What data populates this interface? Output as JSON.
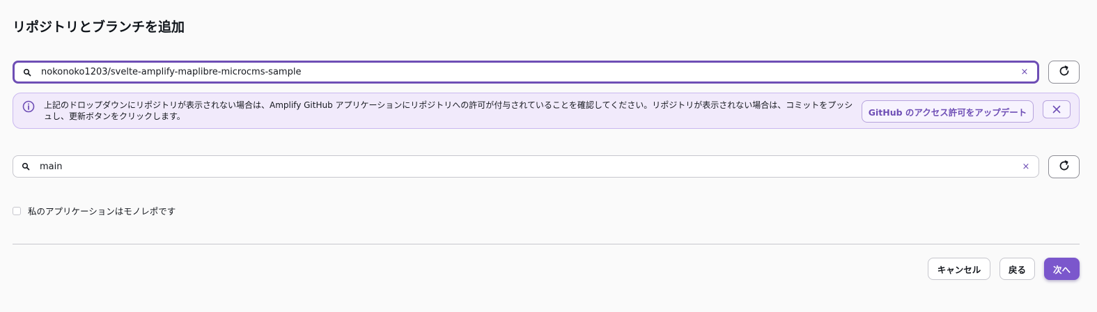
{
  "page_title": "リポジトリとブランチを追加",
  "repository": {
    "value": "nokonoko1203/svelte-amplify-maplibre-microcms-sample",
    "clear_label": "×"
  },
  "info_alert": {
    "message": "上記のドロップダウンにリポジトリが表示されない場合は、Amplify GitHub アプリケーションにリポジトリへの許可が付与されていることを確認してください。リポジトリが表示されない場合は、コミットをプッシュし、更新ボタンをクリックします。",
    "action_label": "GitHub のアクセス許可をアップデート"
  },
  "branch": {
    "value": "main",
    "clear_label": "×"
  },
  "monorepo_checkbox": {
    "label": "私のアプリケーションはモノレポです",
    "checked": false
  },
  "footer": {
    "cancel_label": "キャンセル",
    "back_label": "戻る",
    "next_label": "次へ"
  },
  "colors": {
    "accent": "#6e4eb5",
    "primary_button": "#7b57cc",
    "alert_background": "#f1eafb"
  },
  "icons": {
    "search": "search-icon",
    "clear": "clear-icon",
    "refresh": "refresh-icon",
    "info": "info-icon",
    "close": "close-icon"
  }
}
